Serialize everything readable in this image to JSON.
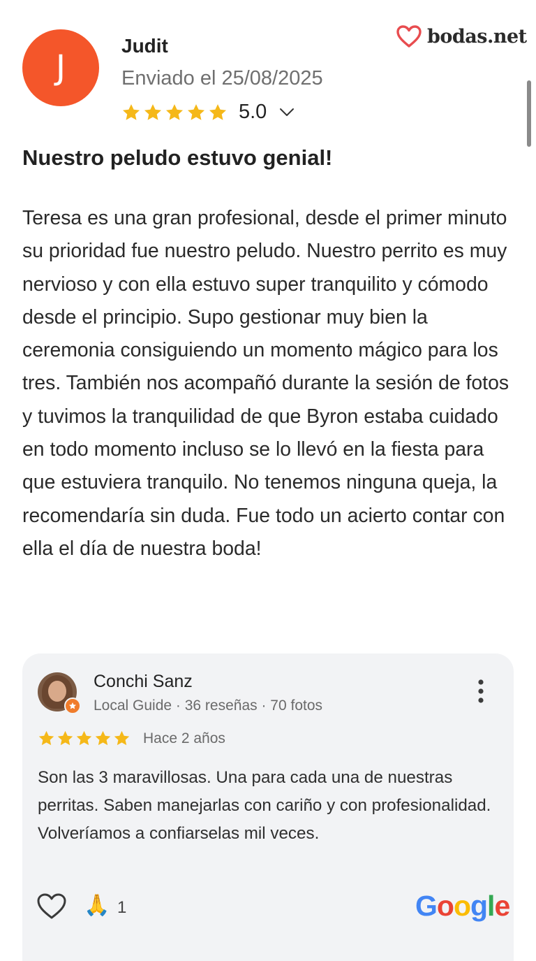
{
  "review": {
    "avatar_initial": "J",
    "author": "Judit",
    "sent_date": "Enviado el 25/08/2025",
    "rating": "5.0",
    "stars": 5,
    "title": "Nuestro peludo estuvo genial!",
    "body": "Teresa es una gran profesional, desde el primer minuto su prioridad fue nuestro peludo. Nuestro perrito es muy nervioso y con ella estuvo super tranquilito y cómodo desde el principio. Supo gestionar muy bien la ceremonia consiguiendo un momento mágico para los tres. También nos acompañó durante la sesión de fotos y tuvimos la tranquilidad de que Byron estaba cuidado en todo momento incluso se lo llevó en la fiesta para que estuviera tranquilo. No tenemos ninguna queja, la recomendaría sin duda. Fue todo un acierto contar con ella el día de nuestra boda!"
  },
  "brand": {
    "name": "bodas.net",
    "icon": "heart-outline-icon",
    "color": "#E84C4F"
  },
  "google_review": {
    "name": "Conchi Sanz",
    "meta": "Local Guide · 36 reseñas · 70 fotos",
    "when": "Hace 2 años",
    "stars": 5,
    "text": "Son las 3 maravillosas. Una para cada una de nuestras perritas. Saben manejarlas con cariño y con profesionalidad. Volveríamos a confiarselas mil veces.",
    "reaction_emoji": "🙏",
    "reaction_count": "1",
    "logo_text": "Google"
  },
  "colors": {
    "avatar_bg": "#F4562A",
    "star": "#F5B819",
    "card_bg": "#f2f3f5",
    "google_blue": "#4285F4",
    "google_red": "#EA4335",
    "google_yellow": "#FBBC05",
    "google_green": "#34A853"
  }
}
